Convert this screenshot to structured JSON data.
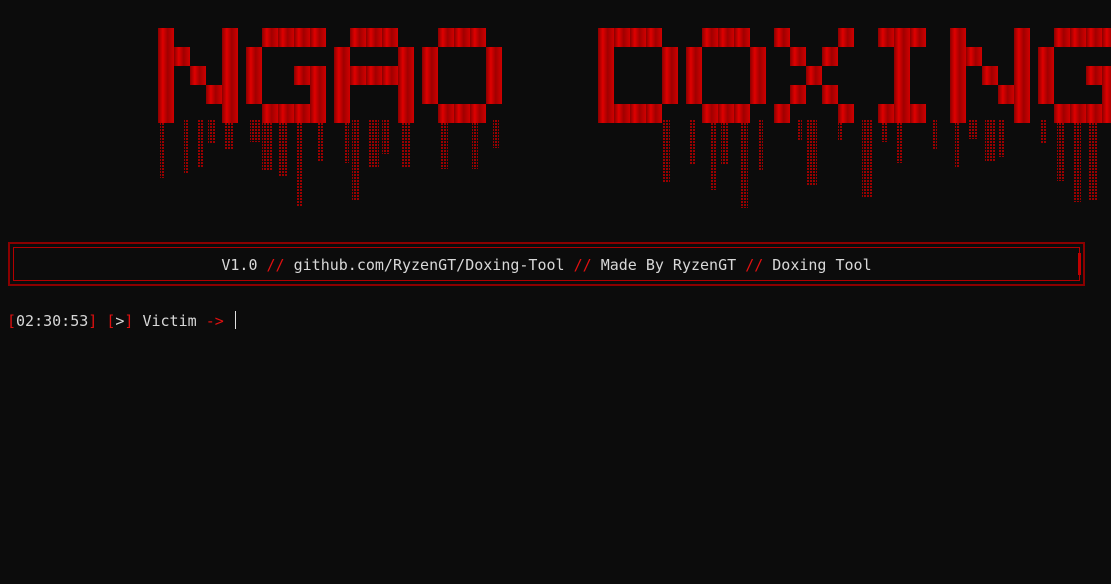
{
  "banner": {
    "logo_text": "NGAO DOXING",
    "accent_color": "#e00000"
  },
  "info": {
    "version": "V1.0",
    "separator": "//",
    "repo": "github.com/RyzenGT/Doxing-Tool",
    "author": "Made By RyzenGT",
    "tool": "Doxing Tool"
  },
  "prompt": {
    "bracket_open": "[",
    "bracket_close": "]",
    "time": "02:30:53",
    "marker": ">",
    "label": "Victim",
    "arrow": "->",
    "input_value": ""
  },
  "colors": {
    "background": "#0c0c0c",
    "text": "#d8d8d8",
    "accent": "#e01010",
    "frame": "#8b0000"
  }
}
